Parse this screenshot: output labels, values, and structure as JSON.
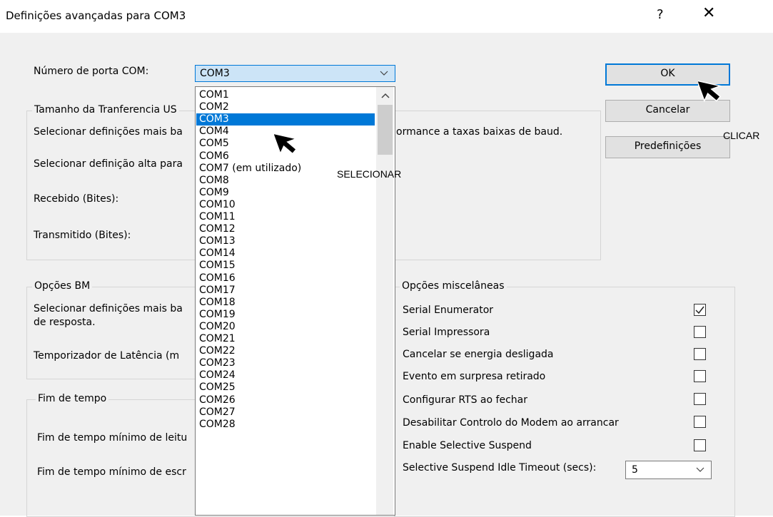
{
  "dialog": {
    "title": "Definições avançadas para COM3",
    "help_label": "?",
    "close_label": "✕"
  },
  "port": {
    "label": "Número de porta COM:",
    "selected": "COM3",
    "options": [
      "COM1",
      "COM2",
      "COM3",
      "COM4",
      "COM5",
      "COM6",
      "COM7 (em utilizado)",
      "COM8",
      "COM9",
      "COM10",
      "COM11",
      "COM12",
      "COM13",
      "COM14",
      "COM15",
      "COM16",
      "COM17",
      "COM18",
      "COM19",
      "COM20",
      "COM21",
      "COM22",
      "COM23",
      "COM24",
      "COM25",
      "COM26",
      "COM27",
      "COM28"
    ],
    "selected_index": 2
  },
  "usb": {
    "title": "Tamanho da Tranferencia US",
    "line1": "Selecionar definições mais ba",
    "line1_tail": "ormance a taxas baixas de baud.",
    "line2": "Selecionar definição alta para",
    "received": "Recebido (Bites):",
    "transmitted": "Transmitido (Bites):"
  },
  "bm": {
    "title": "Opções BM",
    "line1": "Selecionar definições mais ba",
    "line1b": "de resposta.",
    "latency": "Temporizador de Latência (m"
  },
  "timeouts": {
    "title": "Fim de tempo",
    "read": "Fim de tempo mínimo de leitu",
    "write": "Fim de tempo mínimo de escr"
  },
  "misc": {
    "title": "Opções miscelâneas",
    "options": [
      {
        "label": "Serial Enumerator",
        "checked": true
      },
      {
        "label": "Serial Impressora",
        "checked": false
      },
      {
        "label": "Cancelar se energia desligada",
        "checked": false
      },
      {
        "label": "Evento em surpresa retirado",
        "checked": false
      },
      {
        "label": "Configurar RTS ao fechar",
        "checked": false
      },
      {
        "label": "Desabilitar Controlo do Modem ao arrancar",
        "checked": false
      },
      {
        "label": "Enable Selective Suspend",
        "checked": false
      }
    ],
    "idle_label": "Selective Suspend Idle Timeout (secs):",
    "idle_value": "5"
  },
  "buttons": {
    "ok": "OK",
    "cancel": "Cancelar",
    "defaults": "Predefinições"
  },
  "annotations": {
    "select": "SELECIONAR",
    "click": "CLICAR"
  },
  "icons": [
    "help-icon",
    "close-icon",
    "chevron-down-icon",
    "chevron-up-icon",
    "checkmark-icon",
    "cursor-arrow-icon"
  ],
  "colors": {
    "selection": "#0078d7",
    "combo_highlight": "#cce4f7",
    "dialog_bg": "#f0f0f0"
  }
}
